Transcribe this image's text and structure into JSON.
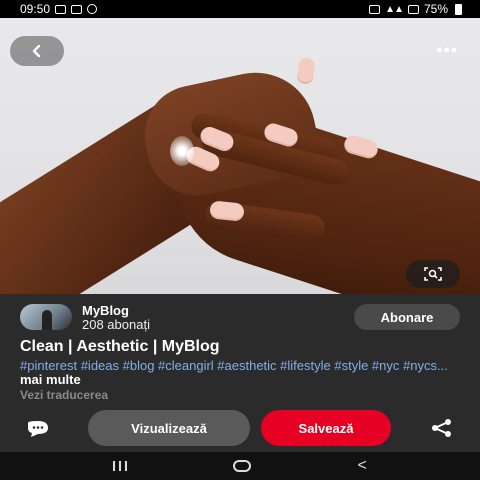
{
  "status_bar": {
    "time": "09:50",
    "battery": "75%"
  },
  "pin": {
    "author": {
      "name": "MyBlog",
      "followers": "208 abonați"
    },
    "follow_label": "Abonare",
    "title": "Clean | Aesthetic | MyBlog",
    "description_tags": "#pinterest #ideas #blog #cleangirl #aesthetic #lifestyle #style #nyc #nycs...",
    "more_label": "mai multe",
    "translate_label": "Vezi traducerea"
  },
  "actions": {
    "view_label": "Vizualizează",
    "save_label": "Salvează"
  },
  "colors": {
    "save": "#e60023",
    "link": "#7fb0e8",
    "panel": "#2b2b2b"
  },
  "icons": [
    "back-arrow-icon",
    "more-icon",
    "visual-search-icon",
    "comment-icon",
    "share-icon"
  ]
}
